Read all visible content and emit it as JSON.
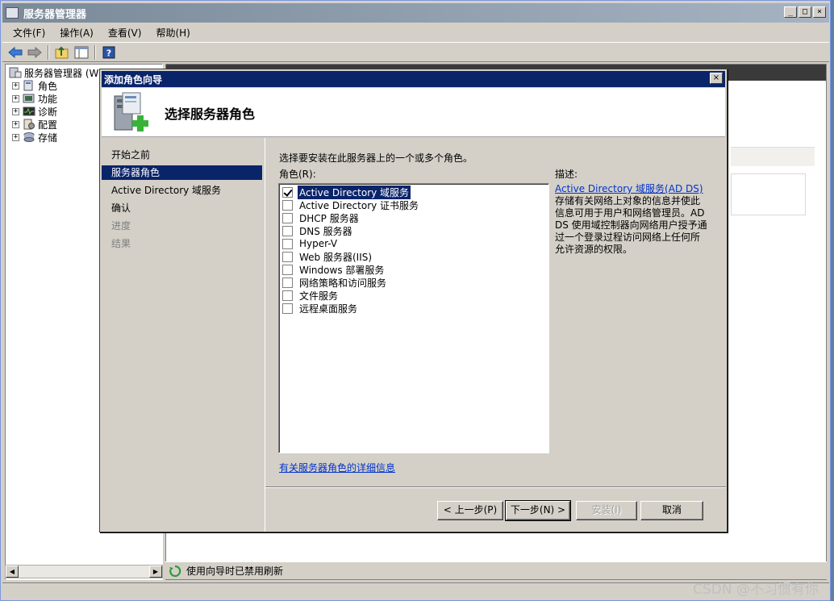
{
  "window": {
    "title": "服务器管理器",
    "minimize": "_",
    "maximize": "□",
    "close": "×"
  },
  "menu": [
    "文件(F)",
    "操作(A)",
    "查看(V)",
    "帮助(H)"
  ],
  "tree": {
    "root": "服务器管理器 (WIN-...",
    "items": [
      "角色",
      "功能",
      "诊断",
      "配置",
      "存储"
    ]
  },
  "status": {
    "text": "使用向导时已禁用刷新"
  },
  "watermark": "CSDN @不习惯有你",
  "dialog": {
    "title": "添加角色向导",
    "close": "×",
    "header_title": "选择服务器角色",
    "steps": [
      {
        "label": "开始之前",
        "state": "normal"
      },
      {
        "label": "服务器角色",
        "state": "active"
      },
      {
        "label": "Active Directory 域服务",
        "state": "normal"
      },
      {
        "label": "确认",
        "state": "normal"
      },
      {
        "label": "进度",
        "state": "disabled"
      },
      {
        "label": "结果",
        "state": "disabled"
      }
    ],
    "instruction": "选择要安装在此服务器上的一个或多个角色。",
    "roles_label": "角色(R):",
    "description_label": "描述:",
    "roles": [
      {
        "label": "Active Directory 域服务",
        "checked": true,
        "selected": true
      },
      {
        "label": "Active Directory 证书服务",
        "checked": false,
        "selected": false
      },
      {
        "label": "DHCP 服务器",
        "checked": false,
        "selected": false
      },
      {
        "label": "DNS 服务器",
        "checked": false,
        "selected": false
      },
      {
        "label": "Hyper-V",
        "checked": false,
        "selected": false
      },
      {
        "label": "Web 服务器(IIS)",
        "checked": false,
        "selected": false
      },
      {
        "label": "Windows 部署服务",
        "checked": false,
        "selected": false
      },
      {
        "label": "网络策略和访问服务",
        "checked": false,
        "selected": false
      },
      {
        "label": "文件服务",
        "checked": false,
        "selected": false
      },
      {
        "label": "远程桌面服务",
        "checked": false,
        "selected": false
      }
    ],
    "description_link": "Active Directory 域服务(AD DS)",
    "description_text": "存储有关网络上对象的信息并使此信息可用于用户和网络管理员。AD DS 使用域控制器向网络用户授予通过一个登录过程访问网络上任何所允许资源的权限。",
    "more_info_link": "有关服务器角色的详细信息",
    "buttons": {
      "back": "< 上一步(P)",
      "next": "下一步(N) >",
      "install": "安装(I)",
      "cancel": "取消"
    }
  },
  "colors": {
    "titlebar_active": "#0a246a",
    "selection": "#0a246a",
    "link": "#0033cc"
  }
}
